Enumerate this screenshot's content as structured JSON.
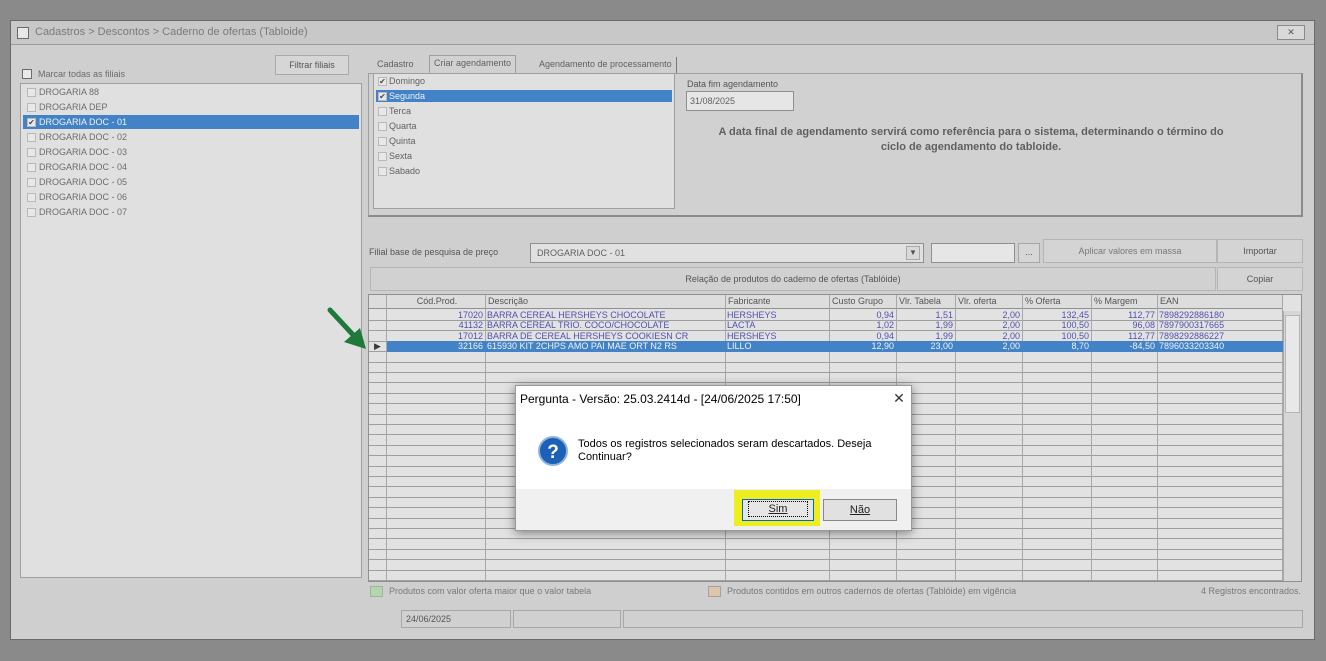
{
  "window": {
    "title": "Cadastros > Descontos > Caderno de ofertas (Tabloide)"
  },
  "left": {
    "check_all_label": "Marcar todas as filiais",
    "filter_button": "Filtrar filiais",
    "filiais": [
      {
        "label": "DROGARIA 88",
        "checked": false,
        "selected": false
      },
      {
        "label": "DROGARIA DEP",
        "checked": false,
        "selected": false
      },
      {
        "label": "DROGARIA DOC - 01",
        "checked": true,
        "selected": true
      },
      {
        "label": "DROGARIA DOC - 02",
        "checked": false,
        "selected": false
      },
      {
        "label": "DROGARIA DOC - 03",
        "checked": false,
        "selected": false
      },
      {
        "label": "DROGARIA DOC - 04",
        "checked": false,
        "selected": false
      },
      {
        "label": "DROGARIA DOC - 05",
        "checked": false,
        "selected": false
      },
      {
        "label": "DROGARIA DOC - 06",
        "checked": false,
        "selected": false
      },
      {
        "label": "DROGARIA DOC - 07",
        "checked": false,
        "selected": false
      }
    ]
  },
  "tabs": [
    "Cadastro",
    "Criar agendamento",
    "Agendamento de processamento"
  ],
  "active_tab": "Criar agendamento",
  "days": [
    {
      "label": "Domingo",
      "checked": true,
      "selected": false
    },
    {
      "label": "Segunda",
      "checked": true,
      "selected": true
    },
    {
      "label": "Terca",
      "checked": false,
      "selected": false
    },
    {
      "label": "Quarta",
      "checked": false,
      "selected": false
    },
    {
      "label": "Quinta",
      "checked": false,
      "selected": false
    },
    {
      "label": "Sexta",
      "checked": false,
      "selected": false
    },
    {
      "label": "Sabado",
      "checked": false,
      "selected": false
    }
  ],
  "schedule": {
    "end_date_label": "Data fim agendamento",
    "end_date_value": "31/08/2025",
    "info_text": "A data final de agendamento servirá como referência para o sistema, determinando o término do ciclo de agendamento do tabloide."
  },
  "toolbar": {
    "filial_base_label": "Filial base de pesquisa de preço",
    "filial_base_value": "DROGARIA DOC - 01",
    "dots_label": "...",
    "apply_mass_label": "Aplicar valores em massa",
    "import_label": "Importar",
    "relacao_label": "Relação de produtos do caderno de ofertas (Tablóide)",
    "copy_label": "Copiar"
  },
  "grid": {
    "columns": [
      "Cód.Prod.",
      "Descrição",
      "Fabricante",
      "Custo Grupo",
      "Vlr. Tabela",
      "Vlr. oferta",
      "% Oferta",
      "% Margem",
      "EAN"
    ],
    "rows": [
      [
        "17020",
        "BARRA CEREAL HERSHEYS CHOCOLATE",
        "HERSHEYS",
        "0,94",
        "1,51",
        "2,00",
        "132,45",
        "112,77",
        "7898292886180"
      ],
      [
        "41132",
        "BARRA CEREAL TRIO. COCO/CHOCOLATE",
        "LACTA",
        "1,02",
        "1,99",
        "2,00",
        "100,50",
        "96,08",
        "7897900317665"
      ],
      [
        "17012",
        "BARRA DE CEREAL HERSHEYS COOKIESN CR",
        "HERSHEYS",
        "0,94",
        "1,99",
        "2,00",
        "100,50",
        "112,77",
        "7898292886227"
      ],
      [
        "32166",
        "615930 KIT 2CHPS AMO PAI  MAE ORT N2 RS",
        "LILLO",
        "12,90",
        "23,00",
        "2,00",
        "8,70",
        "-84,50",
        "7896033203340"
      ]
    ],
    "selected_row": 3
  },
  "legend": {
    "green": "Produtos com valor oferta maior que o valor tabela",
    "orange": "Produtos contidos em outros cadernos de ofertas (Tablóide) em vigência",
    "count": "4 Registros encontrados."
  },
  "status": {
    "date": "24/06/2025"
  },
  "dialog": {
    "title": "Pergunta - Versão: 25.03.2414d - [24/06/2025 17:50]",
    "message": "Todos os registros selecionados seram descartados. Deseja Continuar?",
    "yes_label": "Sim",
    "no_label": "Não",
    "close_glyph": "✕",
    "icon_glyph": "?"
  },
  "colors": {
    "selection": "#0a64c4",
    "highlight": "#ecee1f",
    "arrow": "#1e7a3c"
  }
}
